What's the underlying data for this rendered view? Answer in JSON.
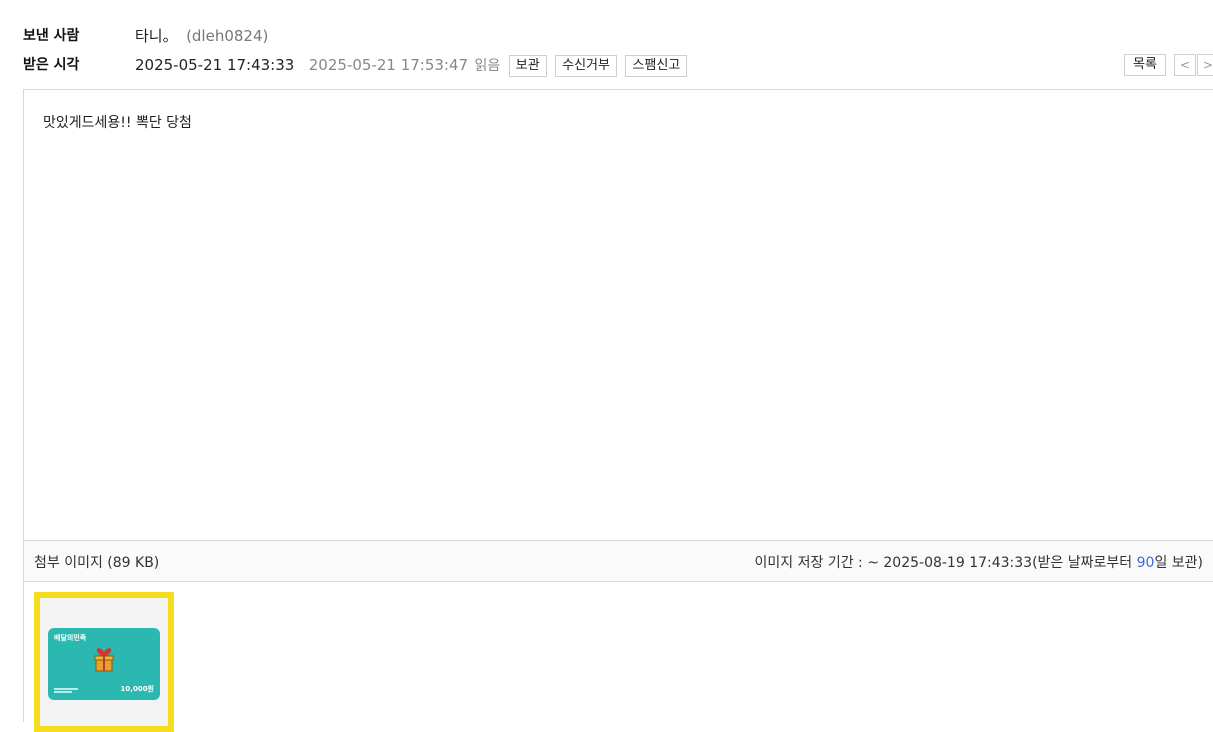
{
  "meta": {
    "sender_label": "보낸 사람",
    "sender_name": "타니。",
    "sender_id": "(dleh0824)",
    "received_label": "받은 시각",
    "sent_time": "2025-05-21 17:43:33",
    "read_time": "2025-05-21 17:53:47",
    "read_label": "읽음"
  },
  "actions": {
    "save": "보관",
    "block": "수신거부",
    "spam": "스팸신고",
    "list": "목록",
    "prev": "<",
    "next": ">"
  },
  "message": {
    "body": "맛있게드세용!! 뽁단 당첨"
  },
  "attachment": {
    "label": "첨부 이미지 (89 KB)",
    "retention_prefix": "이미지 저장 기간 : ~ 2025-08-19 17:43:33(받은 날짜로부터 ",
    "retention_days": "90",
    "retention_suffix": "일 보관)",
    "card_brand": "배달의민족",
    "card_amount": "10,000원"
  },
  "colors": {
    "thumb_border": "#f5dc1f",
    "card_bg": "#2bb8b1",
    "retention_days": "#3d6bd9"
  }
}
